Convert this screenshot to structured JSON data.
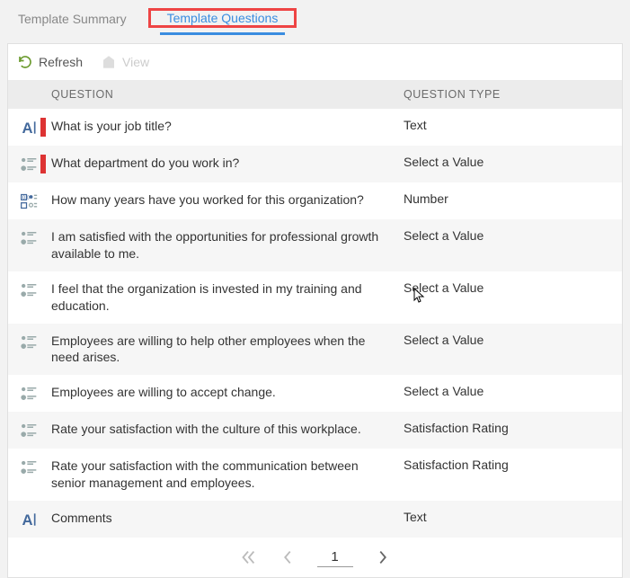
{
  "tabs": {
    "summary": "Template Summary",
    "questions": "Template Questions"
  },
  "toolbar": {
    "refresh": "Refresh",
    "view": "View"
  },
  "headers": {
    "question": "QUESTION",
    "type": "QUESTION TYPE"
  },
  "rows": [
    {
      "icon": "text",
      "required": true,
      "question": "What is your job title?",
      "type": "Text"
    },
    {
      "icon": "select",
      "required": true,
      "question": "What department do you work in?",
      "type": "Select a Value"
    },
    {
      "icon": "number",
      "required": false,
      "question": "How many years have you worked for this organization?",
      "type": "Number"
    },
    {
      "icon": "select",
      "required": false,
      "question": "I am satisfied with the opportunities for professional growth available to me.",
      "type": "Select a Value"
    },
    {
      "icon": "select",
      "required": false,
      "question": "I feel that the organization is invested in my training and education.",
      "type": "Select a Value"
    },
    {
      "icon": "select",
      "required": false,
      "question": "Employees are willing to help other employees when the need arises.",
      "type": "Select a Value"
    },
    {
      "icon": "select",
      "required": false,
      "question": "Employees are willing to accept change.",
      "type": "Select a Value"
    },
    {
      "icon": "select",
      "required": false,
      "question": "Rate your satisfaction with the culture of this workplace.",
      "type": "Satisfaction Rating"
    },
    {
      "icon": "select",
      "required": false,
      "question": "Rate your satisfaction with the communication between senior management and employees.",
      "type": "Satisfaction Rating"
    },
    {
      "icon": "text",
      "required": false,
      "question": "Comments",
      "type": "Text"
    }
  ],
  "pager": {
    "current": "1"
  }
}
